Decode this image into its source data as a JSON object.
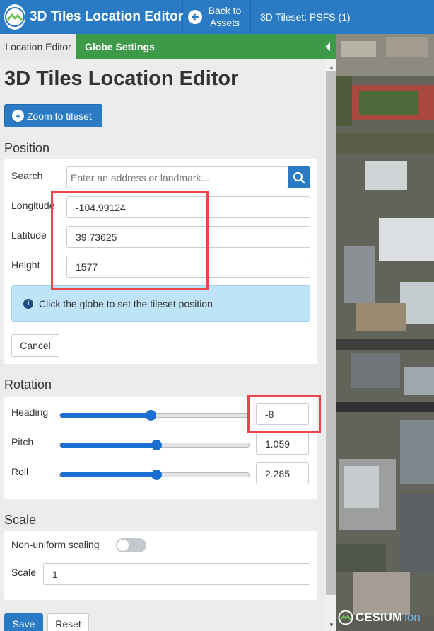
{
  "header": {
    "app_title": "3D Tiles Location Editor",
    "back_label": "Back to Assets",
    "tileset_label": "3D Tileset: PSFS (1)"
  },
  "tabs": {
    "location_editor": "Location Editor",
    "globe_settings": "Globe Settings"
  },
  "page_title": "3D Tiles Location Editor",
  "zoom_button": "Zoom to tileset",
  "position": {
    "heading": "Position",
    "search_label": "Search",
    "search_placeholder": "Enter an address or landmark...",
    "longitude_label": "Longitude",
    "longitude_value": "-104.99124",
    "latitude_label": "Latitude",
    "latitude_value": "39.73625",
    "height_label": "Height",
    "height_value": "1577",
    "info_text": "Click the globe to set the tileset position",
    "cancel_label": "Cancel"
  },
  "rotation": {
    "heading": "Rotation",
    "heading_label": "Heading",
    "heading_value": "-8",
    "heading_fraction": 0.48,
    "pitch_label": "Pitch",
    "pitch_value": "1.059",
    "pitch_fraction": 0.51,
    "roll_label": "Roll",
    "roll_value": "2.285",
    "roll_fraction": 0.51
  },
  "scale": {
    "heading": "Scale",
    "nonuniform_label": "Non-uniform scaling",
    "nonuniform_enabled": false,
    "scale_label": "Scale",
    "scale_value": "1"
  },
  "actions": {
    "save_label": "Save",
    "reset_label": "Reset"
  },
  "map": {
    "logo_text": "CESIUM",
    "logo_suffix": "ion"
  },
  "colors": {
    "primary": "#2a7bc4",
    "tab_green": "#3d9a49",
    "highlight": "#e8464b",
    "slider": "#1a6fd0"
  }
}
